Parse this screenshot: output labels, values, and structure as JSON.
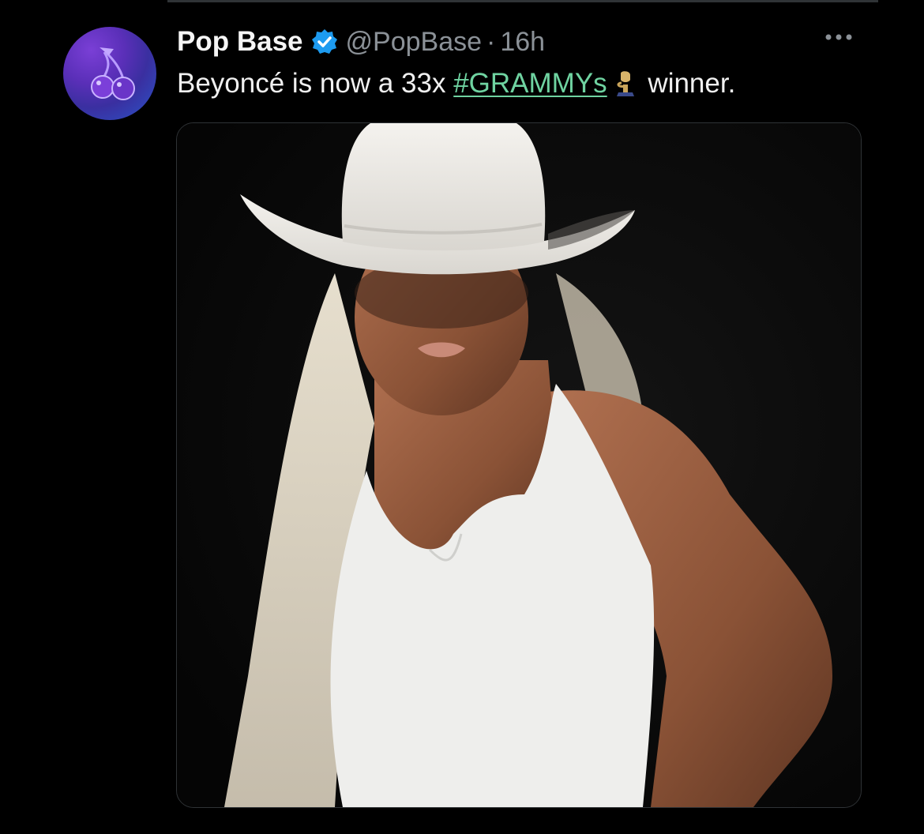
{
  "tweet": {
    "display_name": "Pop Base",
    "handle": "@PopBase",
    "separator": "·",
    "time": "16h",
    "text_before": "Beyoncé is now a 33x ",
    "hashtag": "#GRAMMYs",
    "text_after": " winner.",
    "more_label": "···"
  },
  "icons": {
    "avatar": "cherries-icon",
    "verified": "verified-badge-icon",
    "hashtag_emoji": "grammy-trophy-icon",
    "more": "more-options-icon"
  },
  "colors": {
    "background": "#000000",
    "hashtag": "#6fd3a1",
    "verified": "#1d9bf0",
    "secondary_text": "#8b9197"
  }
}
